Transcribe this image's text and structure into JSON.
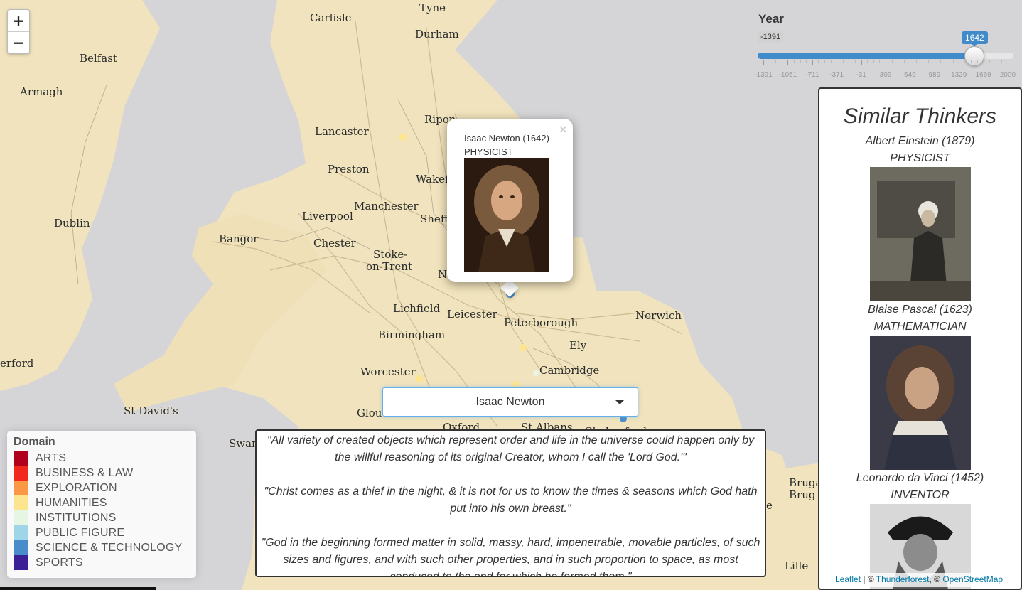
{
  "map": {
    "zoom_in": "+",
    "zoom_out": "−",
    "places": [
      "Tyne",
      "Carlisle",
      "Durham",
      "Belfast",
      "Armagh",
      "Ripon",
      "Lancaster",
      "Preston",
      "Wakef",
      "Dublin",
      "Liverpool",
      "Manchester",
      "Sheff",
      "Bangor",
      "Chester",
      "Stoke-",
      "on-Trent",
      "N",
      "Lichfield",
      "Leicester",
      "Peterborough",
      "Norwich",
      "Birmingham",
      "Ely",
      "erford",
      "Worcester",
      "Cambridge",
      "St David's",
      "Glouc",
      "Oxford",
      "St Albans",
      "Chelmsford",
      "Swan",
      "Bruga",
      "Brug",
      "e",
      "Lille"
    ]
  },
  "year": {
    "title": "Year",
    "min_value": "-1391",
    "current_value": "1642",
    "current_fraction": 0.8635,
    "tick_labels": [
      "-1391",
      "-1051",
      "-711",
      "-371",
      "-31",
      "309",
      "649",
      "989",
      "1329",
      "1669",
      "2000"
    ]
  },
  "popup": {
    "close": "×",
    "title": "Isaac Newton (1642)",
    "subtitle": "PHYSICIST"
  },
  "selector": {
    "value": "Isaac Newton"
  },
  "quotes": [
    "\"All variety of created objects which represent order and life in the universe could happen only by the willful reasoning of its original Creator, whom I call the 'Lord God.'\"",
    "\"Christ comes as a thief in the night, & it is not for us to know the times & seasons which God hath put into his own breast.\"",
    "\"God in the beginning formed matter in solid, massy, hard, impenetrable, movable particles, of such sizes and figures, and with such other properties, and in such proportion to space, as most conduced to the end for which he formed them.\""
  ],
  "legend": {
    "title": "Domain",
    "items": [
      {
        "label": "ARTS",
        "color": "#b0001c"
      },
      {
        "label": "BUSINESS & LAW",
        "color": "#f0281e"
      },
      {
        "label": "EXPLORATION",
        "color": "#fb9845"
      },
      {
        "label": "HUMANITIES",
        "color": "#fde58f"
      },
      {
        "label": "INSTITUTIONS",
        "color": "#e5f6e5"
      },
      {
        "label": "PUBLIC FIGURE",
        "color": "#9ed6e8"
      },
      {
        "label": "SCIENCE & TECHNOLOGY",
        "color": "#4a8cca"
      },
      {
        "label": "SPORTS",
        "color": "#3a1f95"
      }
    ]
  },
  "similar": {
    "title": "Similar Thinkers",
    "thinkers": [
      {
        "name": "Albert Einstein (1879)",
        "job": "PHYSICIST"
      },
      {
        "name": "Blaise Pascal (1623)",
        "job": "MATHEMATICIAN"
      },
      {
        "name": "Leonardo da Vinci (1452)",
        "job": "INVENTOR"
      }
    ]
  },
  "attribution": {
    "leaflet": "Leaflet",
    "sep1": " | © ",
    "thunderforest": "Thunderforest",
    "sep2": ", © ",
    "osm": "OpenStreetMap"
  }
}
